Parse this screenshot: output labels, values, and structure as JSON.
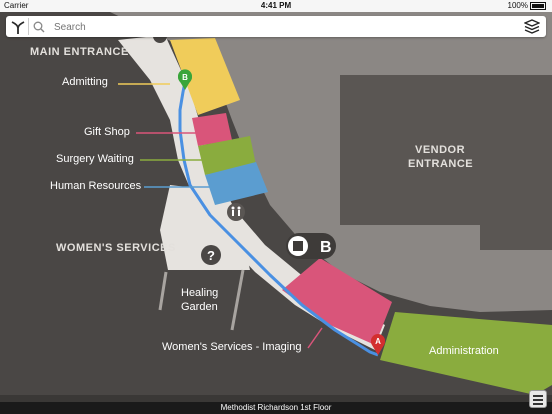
{
  "status": {
    "carrier": "Carrier",
    "time": "4:41 PM",
    "battery": "100%"
  },
  "search": {
    "placeholder": "Search"
  },
  "map": {
    "labels": {
      "main_entrance": "MAIN ENTRANCE",
      "admitting": "Admitting",
      "gift_shop": "Gift Shop",
      "surgery_waiting": "Surgery Waiting",
      "human_resources": "Human Resources",
      "womens_services": "WOMEN'S SERVICES",
      "healing_garden_line1": "Healing",
      "healing_garden_line2": "Garden",
      "womens_imaging": "Women's Services - Imaging",
      "administration": "Administration",
      "vendor_line1": "VENDOR",
      "vendor_line2": "ENTRANCE"
    },
    "markers": {
      "start": "A",
      "end": "B",
      "elevator": "B"
    },
    "colors": {
      "admitting": "#f0cc5a",
      "gift_shop": "#d9557a",
      "surgery_waiting": "#8aac3e",
      "human_resources": "#5b9dd0",
      "imaging": "#d9557a",
      "administration": "#8aac3e",
      "route": "#4a90e2",
      "marker_start": "#d32f2f",
      "marker_end": "#3aa53a"
    }
  },
  "footer": {
    "floor_name": "Methodist Richardson 1st Floor"
  }
}
